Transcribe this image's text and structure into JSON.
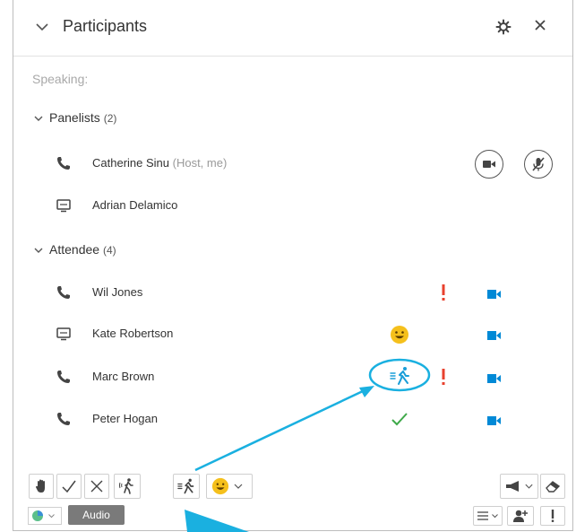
{
  "header": {
    "title": "Participants",
    "collapse_icon": "chevron-down-icon",
    "settings_icon": "gear-icon",
    "close_icon": "close-icon"
  },
  "speaking_label": "Speaking:",
  "panelists": {
    "label": "Panelists",
    "count": "(2)",
    "members": [
      {
        "name": "Catherine Sinu",
        "tag": "(Host, me)",
        "device_icon": "phone-icon"
      },
      {
        "name": "Adrian Delamico",
        "device_icon": "computer-icon"
      }
    ],
    "host_controls": {
      "video_icon": "video-camera-icon",
      "mute_icon": "microphone-muted-icon"
    }
  },
  "attendees": {
    "label": "Attendee",
    "count": "(4)",
    "members": [
      {
        "name": "Wil Jones",
        "device_icon": "phone-icon",
        "status": [
          "exclamation-icon"
        ],
        "video_icon": "video-camera-icon"
      },
      {
        "name": "Kate Robertson",
        "device_icon": "computer-icon",
        "status": [
          "smiley-icon"
        ],
        "video_icon": "video-camera-icon"
      },
      {
        "name": "Marc Brown",
        "device_icon": "phone-icon",
        "status": [
          "running-person-icon",
          "exclamation-icon"
        ],
        "video_icon": "video-camera-icon"
      },
      {
        "name": "Peter Hogan",
        "device_icon": "phone-icon",
        "status": [
          "checkmark-icon"
        ],
        "video_icon": "video-camera-icon"
      }
    ]
  },
  "toolbar": {
    "feedback_icons": [
      "hand-icon",
      "checkmark-icon",
      "x-icon",
      "walking-person-icon",
      "running-person-icon",
      "smiley-dropdown-icon"
    ],
    "right_icons": [
      "megaphone-dropdown-icon",
      "eraser-icon"
    ],
    "audio_label": "Audio",
    "status_icon": "status-dropdown-icon",
    "bottom_right_icons": [
      "list-dropdown-icon",
      "add-person-icon",
      "exclamation-icon"
    ]
  },
  "colors": {
    "accent": "#1ab0e0",
    "video": "#0089d6",
    "alert": "#e8412e",
    "check": "#3fa94a",
    "smiley": "#f5c01c"
  }
}
